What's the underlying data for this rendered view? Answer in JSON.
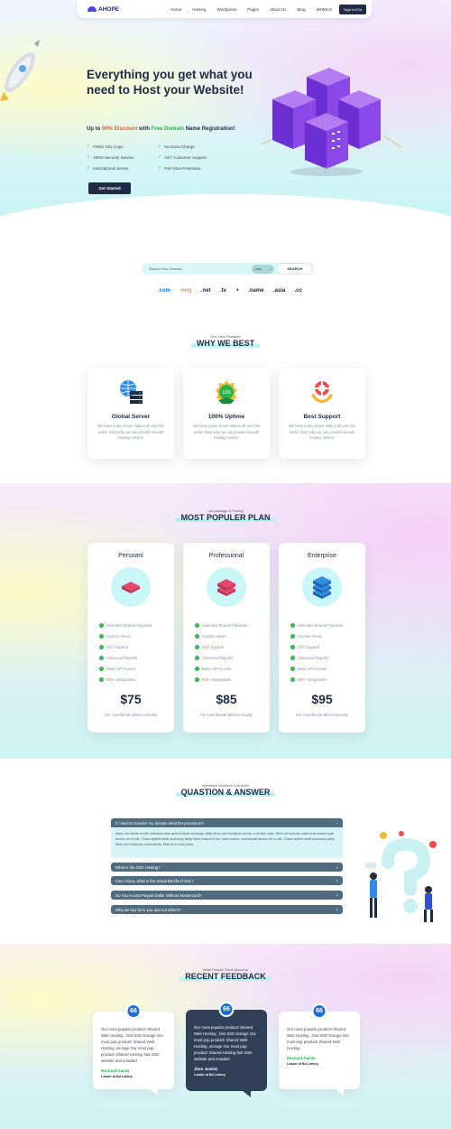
{
  "nav": {
    "logo": "AHOPE",
    "items": [
      "Home",
      "Hosting",
      "Wordpress",
      "Pages",
      "About Us",
      "Blog",
      "WHMCS"
    ],
    "signin": "Sign In/Out"
  },
  "hero": {
    "title": "Everything you get what you need to Host your Website!",
    "sub_prefix": "Up to ",
    "sub_discount": "90% Discount",
    "sub_mid": " with ",
    "sub_free": "Free Domain",
    "sub_suffix": " Name Registration!",
    "features": [
      "FREE SSL Copy",
      "No Extra Charge",
      "100% Security Service",
      "24/7 Customer Support",
      "International Server",
      "Full Virus Protection"
    ],
    "cta": "Get Started"
  },
  "domain": {
    "placeholder": "Search Your Domain",
    "selected_tld": ".com",
    "button": "SEARCH",
    "tlds": [
      ".com",
      "+org",
      ".net",
      ".tv",
      "+",
      ".name",
      ".asia",
      ".cc"
    ]
  },
  "why": {
    "eyebrow": "Our Core Features",
    "heading": "WHY WE BEST",
    "cards": [
      {
        "title": "Global Server",
        "text": "We have many server station all over the world, thats why we can provide smooth hosting service"
      },
      {
        "title": "100% Uptime",
        "text": "We have many server station all over the world, thats why we can provide smooth hosting service"
      },
      {
        "title": "Best Support",
        "text": "We have many server station all over the world, thats why we can provide smooth hosting service"
      }
    ]
  },
  "pricing": {
    "eyebrow": "our package & Pricing",
    "heading": "MOST POPULER PLAN",
    "plans": [
      {
        "name": "Persoanl",
        "price": "$75",
        "per": "Per User/Month Billed Annually"
      },
      {
        "name": "Professional",
        "price": "$85",
        "per": "Per User/Month Billed Annually"
      },
      {
        "name": "Enterprise",
        "price": "$95",
        "per": "Per User/Month Billed Annually"
      }
    ],
    "features": [
      "Unlimited Shared Pipelines",
      "Custom Views",
      "24/7 Support",
      "Advanced Reports",
      "Basic API Access",
      "900+ Integrations"
    ]
  },
  "faq": {
    "eyebrow": "Important Question & Answer",
    "heading": "QUASTION & ANSWER",
    "open_q": "If i want to transfer my domain what the procedure?",
    "open_a": "Nam nec tellus a odio tincidunt lass aptent taciti sociosqu adlip litore per inceptos auctor a ornare odio. Sed non mauris vitae erat conse quat auctor eu in elit. Class aptent taciti sociosqu adlip litore torquent per obia nostra, consequat auctor eu in elit. Class aptent taciti sociosqu adlip litore per inceptos himenaeos. Mauris in erat justo.",
    "questions": [
      "What is the SSD Hosting?",
      "Can I know, what is the actual Benifit of SSL?",
      "Do You Accept Paypal Dollar Without Mastercard?",
      "Why we buy form you and not others?"
    ],
    "open_icon": "minus-icon",
    "closed_icon": "plus-icon"
  },
  "feedback": {
    "eyebrow": "What People Think About us",
    "heading": "RECENT FEEDBACK",
    "quote_mark": "66",
    "items": [
      {
        "text": "Our most popular product! Shared Web Hosting , fast SSD storage Our most pop product! Shared Web Hosting ,storage Our most pop product! Shared Hosting fast SSD website and emaded",
        "name": "Rechard Gamla",
        "role": "Leader at Bd Lottery"
      },
      {
        "text": "Our most popular product! Shared Web Hosting , fast SSD storage Our most pop product! Shared Web Hosting ,storage Our most pop product! Shared Hosting fast SSD website and emaded",
        "name": "Jhon Joshim",
        "role": "Leader at Bd Lottery"
      },
      {
        "text": "Our most popular product! Shared Web Hosting , fast SSD storage Our most pop product! Shared Web Hosting",
        "name": "Rechard Gamla",
        "role": "Leader at Bd Lottery"
      }
    ]
  }
}
